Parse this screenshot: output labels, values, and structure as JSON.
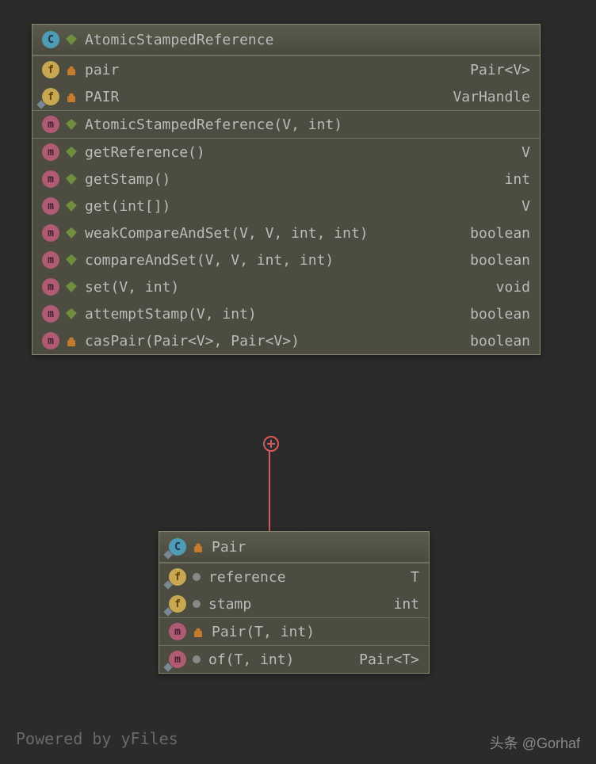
{
  "class1": {
    "name": "AtomicStampedReference",
    "fields": [
      {
        "name": "pair",
        "type": "Pair<V>",
        "vis": "private",
        "sub": false
      },
      {
        "name": "PAIR",
        "type": "VarHandle",
        "vis": "private",
        "sub": true
      }
    ],
    "constructors": [
      {
        "name": "AtomicStampedReference(V, int)",
        "vis": "public"
      }
    ],
    "methods": [
      {
        "name": "getReference()",
        "type": "V",
        "vis": "public"
      },
      {
        "name": "getStamp()",
        "type": "int",
        "vis": "public"
      },
      {
        "name": "get(int[])",
        "type": "V",
        "vis": "public"
      },
      {
        "name": "weakCompareAndSet(V, V, int, int)",
        "type": "boolean",
        "vis": "public"
      },
      {
        "name": "compareAndSet(V, V, int, int)",
        "type": "boolean",
        "vis": "public"
      },
      {
        "name": "set(V, int)",
        "type": "void",
        "vis": "public"
      },
      {
        "name": "attemptStamp(V, int)",
        "type": "boolean",
        "vis": "public"
      },
      {
        "name": "casPair(Pair<V>, Pair<V>)",
        "type": "boolean",
        "vis": "private"
      }
    ]
  },
  "class2": {
    "name": "Pair",
    "fields": [
      {
        "name": "reference",
        "type": "T",
        "vis": "package",
        "sub": true
      },
      {
        "name": "stamp",
        "type": "int",
        "vis": "package",
        "sub": true
      }
    ],
    "constructors": [
      {
        "name": "Pair(T, int)",
        "vis": "private"
      }
    ],
    "methods": [
      {
        "name": "of(T, int)",
        "type": "Pair<T>",
        "vis": "package",
        "sub": true
      }
    ]
  },
  "footer": {
    "left": "Powered by yFiles",
    "right": "头条 @Gorhaf"
  }
}
